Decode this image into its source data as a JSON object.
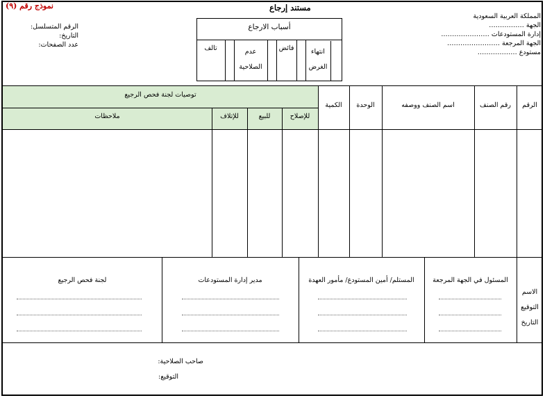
{
  "form_number": "نموذج رقم (٩)",
  "title": "مستند إرجاع",
  "header_right": {
    "kingdom": "المملكة العربية السعودية",
    "entity": "الجهة",
    "entity_dots": "…………….",
    "warehouses_admin": "إدارة المستودعات",
    "warehouses_admin_dots": "………………….",
    "returning_entity": "الجهة المرجعة",
    "returning_entity_dots": "……………………",
    "warehouse": "مستودع",
    "warehouse_dots": "………………"
  },
  "header_left": {
    "serial": "الرقم المتسلسل:",
    "date": "التاريخ:",
    "pages": "عدد الصفحات:"
  },
  "return_reasons": {
    "title": "أسباب الارجاع",
    "options": [
      "انتهاء الغرض",
      "فائض",
      "عدم الصلاحية",
      "تالف"
    ]
  },
  "table": {
    "headers": {
      "number": "الرقم",
      "item_number": "رقم الصنف",
      "item_name": "اسم الصنف ووصفه",
      "unit": "الوحدة",
      "quantity": "الكمية",
      "recommendations": "توصيات لجنة فحص الرجيع",
      "for_repair": "للإصلاح",
      "for_sale": "للبيع",
      "for_destruction": "للإتلاف",
      "notes": "ملاحظات"
    }
  },
  "signatures": {
    "row_labels": [
      "الاسم",
      "التوقيع",
      "التاريخ"
    ],
    "columns": [
      "المسئول في الجهة المرجعة",
      "المستلم/ أمين المستودع/ مأمور العهدة",
      "مدير إدارة المستودعات",
      "لجنة فحص الرجيع"
    ]
  },
  "authority": {
    "holder": "صاحب الصلاحية:",
    "signature": "التوقيع:"
  }
}
